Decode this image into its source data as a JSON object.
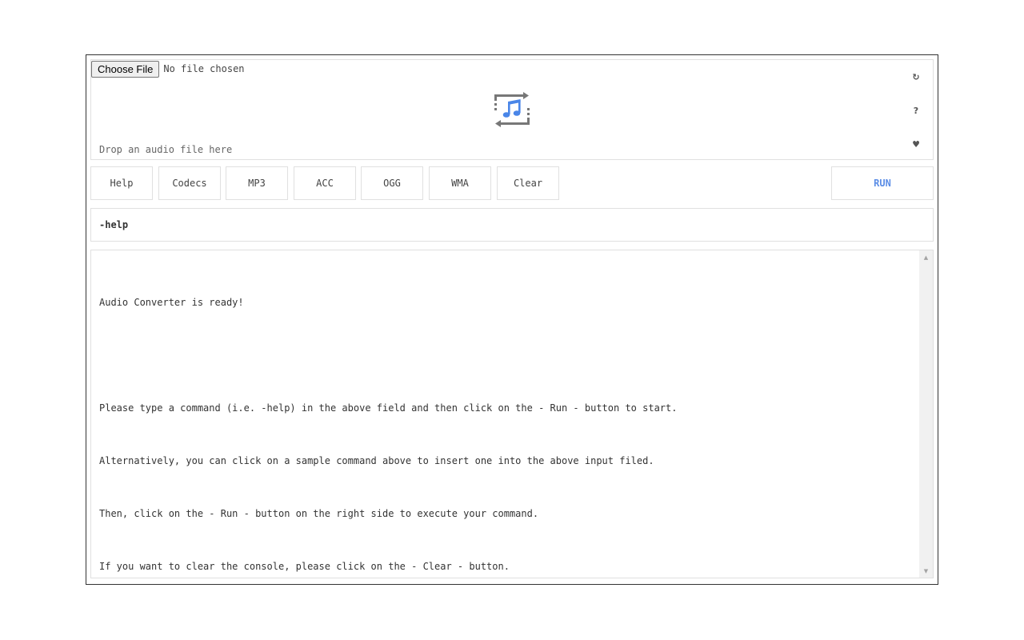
{
  "file_input": {
    "button_label": "Choose File",
    "status": "No file chosen"
  },
  "dropzone": {
    "hint": "Drop an audio file here",
    "center_icon": "audio-convert-icon",
    "icon_color": "#4a86e8"
  },
  "side_icons": {
    "refresh": {
      "icon": "refresh-icon",
      "glyph": "↻"
    },
    "help": {
      "icon": "question-icon",
      "glyph": "?"
    },
    "like": {
      "icon": "heart-icon",
      "glyph": "♥"
    }
  },
  "toolbar": {
    "buttons": [
      {
        "label": "Help"
      },
      {
        "label": "Codecs"
      },
      {
        "label": "MP3"
      },
      {
        "label": "ACC"
      },
      {
        "label": "OGG"
      },
      {
        "label": "WMA"
      },
      {
        "label": "Clear"
      }
    ],
    "run_label": "RUN",
    "run_color": "#5b8de6"
  },
  "command": {
    "value": "-help"
  },
  "console": {
    "lines": [
      "Audio Converter is ready!",
      "",
      "Please type a command (i.e. -help) in the above field and then click on the - Run - button to start.",
      "Alternatively, you can click on a sample command above to insert one into the above input filed.",
      "Then, click on the - Run - button on the right side to execute your command.",
      "If you want to clear the console, please click on the - Clear - button."
    ]
  }
}
